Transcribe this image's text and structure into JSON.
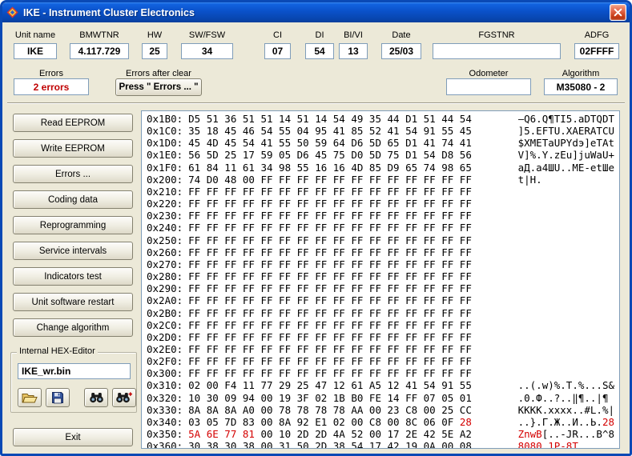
{
  "window": {
    "title": "IKE - Instrument Cluster Electronics",
    "icons": [
      "app-icon",
      "close-icon"
    ]
  },
  "colors": {
    "titlebar_blue": "#0A51C9",
    "window_bg": "#ECE9D8",
    "error_red": "#C00000",
    "highlight_red": "#D40000"
  },
  "info_fields": {
    "unit_name": {
      "label": "Unit name",
      "value": "IKE"
    },
    "bmwtnr": {
      "label": "BMWTNR",
      "value": "4.117.729"
    },
    "hw": {
      "label": "HW",
      "value": "25"
    },
    "sw_fsw": {
      "label": "SW/FSW",
      "value": "34"
    },
    "ci": {
      "label": "CI",
      "value": "07"
    },
    "di": {
      "label": "DI",
      "value": "54"
    },
    "bi_vi": {
      "label": "BI/VI",
      "value": "13"
    },
    "date": {
      "label": "Date",
      "value": "25/03"
    },
    "fgstnr": {
      "label": "FGSTNR",
      "value": ""
    },
    "adfg": {
      "label": "ADFG",
      "value": "02FFFF"
    },
    "errors": {
      "label": "Errors",
      "value": "2 errors"
    },
    "errors_after_clear": {
      "label": "Errors after clear",
      "button_label": "Press \" Errors ... \""
    },
    "odometer": {
      "label": "Odometer",
      "value": ""
    },
    "algorithm": {
      "label": "Algorithm",
      "value": "M35080 - 2"
    }
  },
  "sidebar": {
    "buttons": [
      "Read EEPROM",
      "Write EEPROM",
      "Errors ...",
      "Coding data",
      "Reprogramming",
      "Service intervals",
      "Indicators test",
      "Unit software restart",
      "Change algorithm"
    ]
  },
  "hex_editor_group": {
    "title": "Internal HEX-Editor",
    "filename": "IKE_wr.bin",
    "icon_buttons": [
      "open-folder-icon",
      "save-icon",
      "find-icon",
      "find-next-icon"
    ]
  },
  "exit_button": "Exit",
  "hex_dump": {
    "rows": [
      {
        "addr": "0x1B0:",
        "hex": [
          [
            "",
            "D5 51 36 51 51 14 51 14 54 49 35 44 D1 51 44 54"
          ]
        ],
        "ascii": [
          [
            "",
            "—Q6.Q¶TI5.aDTQDT"
          ]
        ]
      },
      {
        "addr": "0x1C0:",
        "hex": [
          [
            "",
            "35 18 45 46 54 55 04 95 41 85 52 41 54 91 55 45"
          ]
        ],
        "ascii": [
          [
            "",
            "]5.EFTU.XAERATCU"
          ]
        ]
      },
      {
        "addr": "0x1D0:",
        "hex": [
          [
            "",
            "45 4D 45 54 41 55 50 59 64 D6 5D 65 D1 41 74 41"
          ]
        ],
        "ascii": [
          [
            "",
            "$XMETaUPYdэ]eTAt"
          ]
        ]
      },
      {
        "addr": "0x1E0:",
        "hex": [
          [
            "",
            "56 5D 25 17 59 05 D6 45 75 D0 5D 75 D1 54 D8 56"
          ]
        ],
        "ascii": [
          [
            "",
            "V]%.Y.zEu]juWaU+"
          ]
        ]
      },
      {
        "addr": "0x1F0:",
        "hex": [
          [
            "",
            "61 84 11 61 34 98 55 16 16 4D 85 D9 65 74 98 65"
          ]
        ],
        "ascii": [
          [
            "",
            "aД.a4ШU..ME-etШe"
          ]
        ]
      },
      {
        "addr": "0x200:",
        "hex": [
          [
            "",
            "74 D0 48 00 FF FF FF FF FF FF FF FF FF FF FF FF"
          ]
        ],
        "ascii": [
          [
            "",
            "t|H."
          ]
        ]
      },
      {
        "addr": "0x210:",
        "hex": [
          [
            "",
            "FF FF FF FF FF FF FF FF FF FF FF FF FF FF FF FF"
          ]
        ],
        "ascii": [
          [
            "",
            ""
          ]
        ]
      },
      {
        "addr": "0x220:",
        "hex": [
          [
            "",
            "FF FF FF FF FF FF FF FF FF FF FF FF FF FF FF FF"
          ]
        ],
        "ascii": [
          [
            "",
            ""
          ]
        ]
      },
      {
        "addr": "0x230:",
        "hex": [
          [
            "",
            "FF FF FF FF FF FF FF FF FF FF FF FF FF FF FF FF"
          ]
        ],
        "ascii": [
          [
            "",
            ""
          ]
        ]
      },
      {
        "addr": "0x240:",
        "hex": [
          [
            "",
            "FF FF FF FF FF FF FF FF FF FF FF FF FF FF FF FF"
          ]
        ],
        "ascii": [
          [
            "",
            ""
          ]
        ]
      },
      {
        "addr": "0x250:",
        "hex": [
          [
            "",
            "FF FF FF FF FF FF FF FF FF FF FF FF FF FF FF FF"
          ]
        ],
        "ascii": [
          [
            "",
            ""
          ]
        ]
      },
      {
        "addr": "0x260:",
        "hex": [
          [
            "",
            "FF FF FF FF FF FF FF FF FF FF FF FF FF FF FF FF"
          ]
        ],
        "ascii": [
          [
            "",
            ""
          ]
        ]
      },
      {
        "addr": "0x270:",
        "hex": [
          [
            "",
            "FF FF FF FF FF FF FF FF FF FF FF FF FF FF FF FF"
          ]
        ],
        "ascii": [
          [
            "",
            ""
          ]
        ]
      },
      {
        "addr": "0x280:",
        "hex": [
          [
            "",
            "FF FF FF FF FF FF FF FF FF FF FF FF FF FF FF FF"
          ]
        ],
        "ascii": [
          [
            "",
            ""
          ]
        ]
      },
      {
        "addr": "0x290:",
        "hex": [
          [
            "",
            "FF FF FF FF FF FF FF FF FF FF FF FF FF FF FF FF"
          ]
        ],
        "ascii": [
          [
            "",
            ""
          ]
        ]
      },
      {
        "addr": "0x2A0:",
        "hex": [
          [
            "",
            "FF FF FF FF FF FF FF FF FF FF FF FF FF FF FF FF"
          ]
        ],
        "ascii": [
          [
            "",
            ""
          ]
        ]
      },
      {
        "addr": "0x2B0:",
        "hex": [
          [
            "",
            "FF FF FF FF FF FF FF FF FF FF FF FF FF FF FF FF"
          ]
        ],
        "ascii": [
          [
            "",
            ""
          ]
        ]
      },
      {
        "addr": "0x2C0:",
        "hex": [
          [
            "",
            "FF FF FF FF FF FF FF FF FF FF FF FF FF FF FF FF"
          ]
        ],
        "ascii": [
          [
            "",
            ""
          ]
        ]
      },
      {
        "addr": "0x2D0:",
        "hex": [
          [
            "",
            "FF FF FF FF FF FF FF FF FF FF FF FF FF FF FF FF"
          ]
        ],
        "ascii": [
          [
            "",
            ""
          ]
        ]
      },
      {
        "addr": "0x2E0:",
        "hex": [
          [
            "",
            "FF FF FF FF FF FF FF FF FF FF FF FF FF FF FF FF"
          ]
        ],
        "ascii": [
          [
            "",
            ""
          ]
        ]
      },
      {
        "addr": "0x2F0:",
        "hex": [
          [
            "",
            "FF FF FF FF FF FF FF FF FF FF FF FF FF FF FF FF"
          ]
        ],
        "ascii": [
          [
            "",
            ""
          ]
        ]
      },
      {
        "addr": "0x300:",
        "hex": [
          [
            "",
            "FF FF FF FF FF FF FF FF FF FF FF FF FF FF FF FF"
          ]
        ],
        "ascii": [
          [
            "",
            ""
          ]
        ]
      },
      {
        "addr": "0x310:",
        "hex": [
          [
            "",
            "02 00 F4 11 77 29 25 47 12 61 A5 12 41 54 91 55"
          ]
        ],
        "ascii": [
          [
            "",
            "..(.w)%.T.%...S&"
          ]
        ]
      },
      {
        "addr": "0x320:",
        "hex": [
          [
            "",
            "10 30 09 94 00 19 3F 02 1B B0 FE 14 FF 07 05 01"
          ]
        ],
        "ascii": [
          [
            "",
            ".0.Ф..?..‖¶..|¶"
          ]
        ]
      },
      {
        "addr": "0x330:",
        "hex": [
          [
            "",
            "8A 8A 8A A0 00 78 78 78 78 AA 00 23 C8 00 25 CC"
          ]
        ],
        "ascii": [
          [
            "",
            "KKKK.xxxx..#L.%|"
          ]
        ]
      },
      {
        "addr": "0x340:",
        "hex": [
          [
            "",
            "03 05 7D 83 00 8A 92 E1 02 00 C8 00 8C 06 0F "
          ],
          [
            "red",
            "28"
          ]
        ],
        "ascii": [
          [
            "",
            "..}.Г.Ж..И..Ь."
          ],
          [
            "red",
            "28"
          ]
        ]
      },
      {
        "addr": "0x350:",
        "hex": [
          [
            "red",
            "5A 6E 77 81"
          ],
          [
            "",
            " 00 10 2D 2D 4A 52 00 17 2E 42 5E A2"
          ]
        ],
        "ascii": [
          [
            "red",
            "ZnwB"
          ],
          [
            "",
            "[..-JR...B^8"
          ]
        ]
      },
      {
        "addr": "0x360:",
        "hex": [
          [
            "",
            "30 38 30 38 00 31 50 2D 38 54 17 42 19 0A 00 08"
          ]
        ],
        "ascii": [
          [
            "red",
            "8080.1Р-8Т"
          ],
          [
            "",
            ".."
          ]
        ]
      }
    ]
  }
}
